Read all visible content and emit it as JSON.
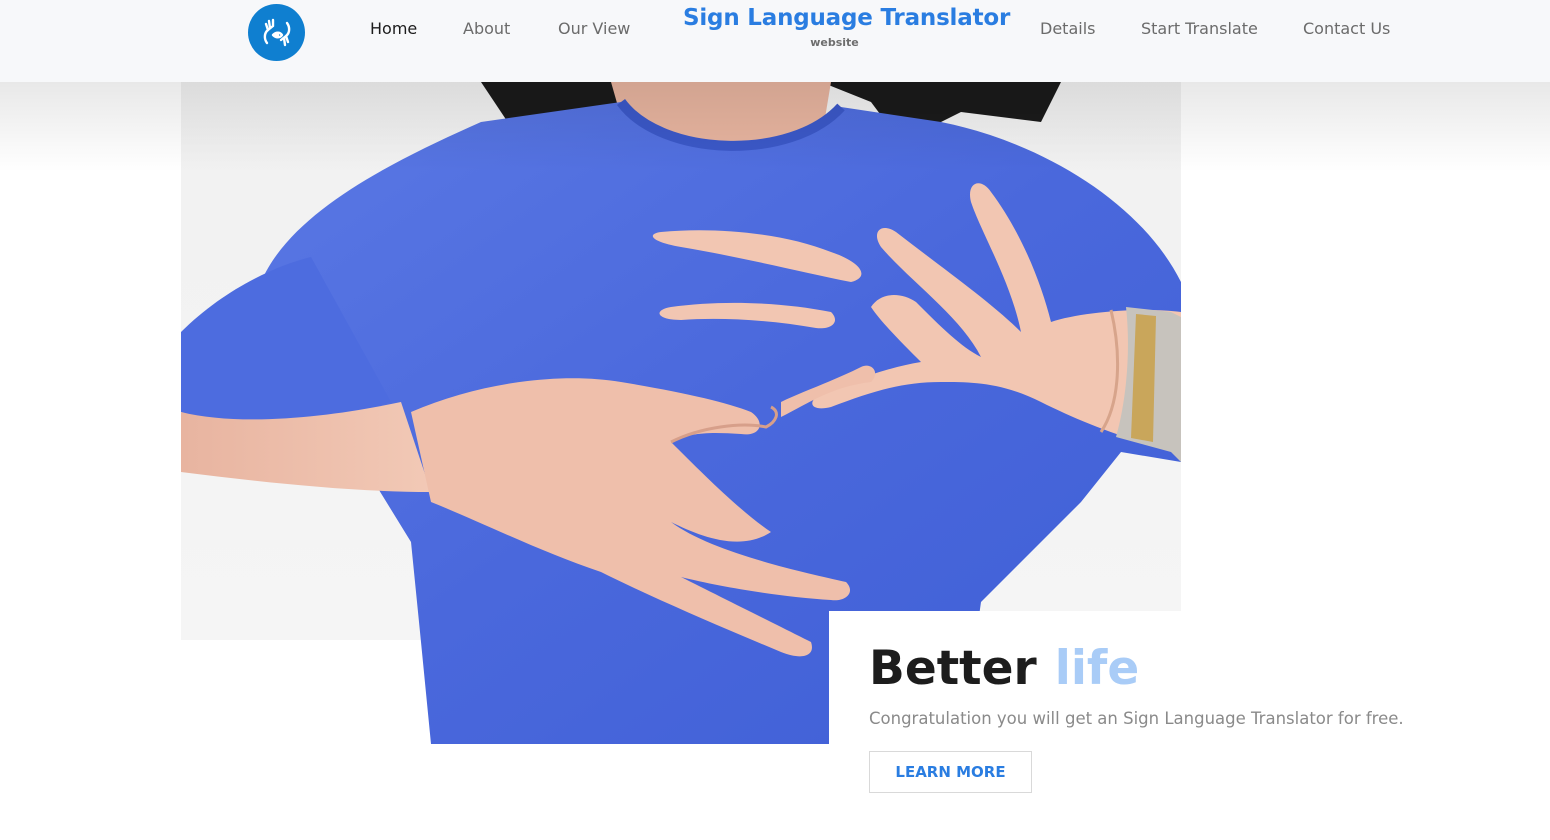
{
  "header": {
    "brand_title": "Sign Language Translator",
    "brand_subtitle": "website",
    "logo_icon": "sign-language-hands-icon",
    "nav": {
      "home": "Home",
      "about": "About",
      "our_view": "Our View",
      "details": "Details",
      "start_translate": "Start Translate",
      "contact_us": "Contact Us"
    },
    "active_nav": "Home"
  },
  "hero": {
    "image_icon": "sign-language-photo",
    "headline_word1": "Better",
    "headline_word2": "life",
    "tagline": "Congratulation you will get an Sign Language Translator for free.",
    "cta_label": "LEARN MORE"
  },
  "colors": {
    "brand_blue": "#2a7de1",
    "logo_blue": "#0f7fd0",
    "headline_dark": "#1d1d1d",
    "headline_light": "#a9ccf7",
    "shirt_blue": "#4f6ee0"
  }
}
